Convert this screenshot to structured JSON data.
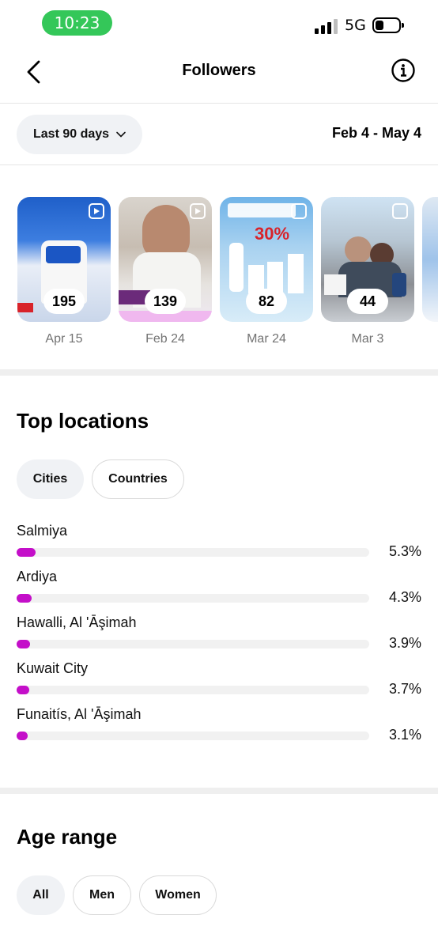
{
  "status_bar": {
    "time": "10:23",
    "network": "5G",
    "time_pill_color": "#34c759"
  },
  "header": {
    "title": "Followers",
    "back_icon": "chevron-left-icon",
    "info_icon": "info-circle-icon"
  },
  "date_filter": {
    "selected": "Last 90 days",
    "range": "Feb 4 - May 4"
  },
  "reels": [
    {
      "count": "195",
      "date": "Apr 15"
    },
    {
      "count": "139",
      "date": "Feb 24"
    },
    {
      "count": "82",
      "date": "Mar 24"
    },
    {
      "count": "44",
      "date": "Mar 3"
    }
  ],
  "top_locations": {
    "title": "Top locations",
    "tabs": [
      {
        "label": "Cities",
        "active": true
      },
      {
        "label": "Countries",
        "active": false
      }
    ],
    "accent_color": "#c40fc9",
    "rows": [
      {
        "name": "Salmiya",
        "percent": "5.3%"
      },
      {
        "name": "Ardiya",
        "percent": "4.3%"
      },
      {
        "name": "Hawalli, Al 'Āşimah",
        "percent": "3.9%"
      },
      {
        "name": "Kuwait City",
        "percent": "3.7%"
      },
      {
        "name": "Funaitís, Al 'Āşimah",
        "percent": "3.1%"
      }
    ]
  },
  "age_range": {
    "title": "Age range",
    "tabs": [
      {
        "label": "All",
        "active": true
      },
      {
        "label": "Men",
        "active": false
      },
      {
        "label": "Women",
        "active": false
      }
    ]
  }
}
